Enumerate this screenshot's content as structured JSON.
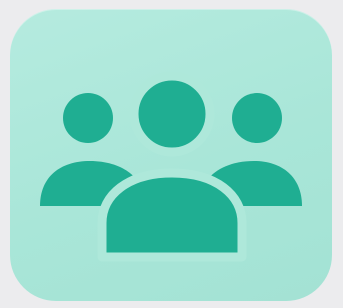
{
  "app_icon": {
    "icon": "users-group-icon",
    "colors": {
      "page_background": "#ececee",
      "tile_background": "#aee8da",
      "glyph": "#1fae92",
      "glyph_gap": "#aee8da"
    }
  }
}
